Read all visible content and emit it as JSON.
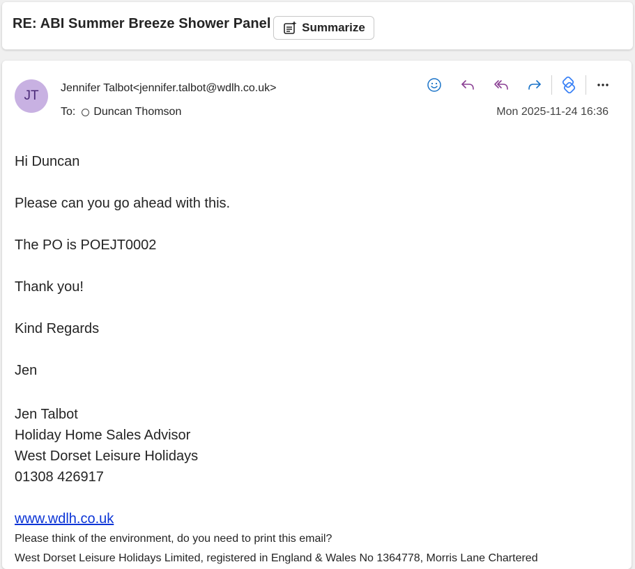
{
  "subject": "RE: ABI Summer Breeze Shower Panel",
  "summarize_label": "Summarize",
  "sender": {
    "initials": "JT",
    "from": "Jennifer Talbot<jennifer.talbot@wdlh.co.uk>",
    "to_label": "To:",
    "to_name": "Duncan Thomson",
    "date": "Mon 2025-11-24 16:36"
  },
  "actions": {
    "icons": [
      "smiley-icon",
      "reply-icon",
      "reply-all-icon",
      "forward-icon",
      "loop-icon",
      "more-icon"
    ],
    "colors": {
      "smiley": "#1a73c8",
      "reply": "#8a3f93",
      "reply_all": "#8a3f93",
      "forward": "#1a73c8",
      "loop": "#3b82f6"
    }
  },
  "body": {
    "greeting": "Hi Duncan",
    "line1": "Please can you go ahead with this.",
    "line2": "The PO is POEJT0002",
    "line3": "Thank you!",
    "closing": "Kind Regards",
    "name_short": "Jen",
    "sig_name": "Jen Talbot",
    "sig_title": "Holiday Home Sales Advisor",
    "sig_company": "West Dorset Leisure Holidays",
    "sig_phone": "01308 426917",
    "website": "www.wdlh.co.uk",
    "env_note": "Please think of the environment, do you need to print this email?",
    "legal": "West Dorset Leisure Holidays Limited, registered in England & Wales No 1364778, Morris Lane Chartered"
  }
}
